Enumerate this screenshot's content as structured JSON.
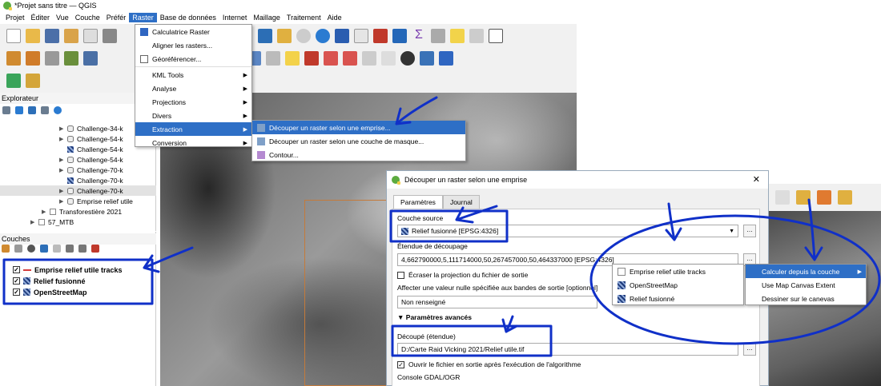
{
  "window": {
    "title": "*Projet sans titre — QGIS"
  },
  "menubar": {
    "items": [
      "Projet",
      "Éditer",
      "Vue",
      "Couche",
      "Préfér",
      "Raster",
      "Base de données",
      "Internet",
      "Maillage",
      "Traitement",
      "Aide"
    ],
    "active": "Raster"
  },
  "raster_menu": {
    "items": [
      {
        "label": "Calculatrice Raster",
        "icon": "calculator-icon"
      },
      {
        "label": "Aligner les rasters...",
        "icon": ""
      },
      {
        "label": "Géoréférencer...",
        "icon": "georeference-icon"
      },
      {
        "label": "KML Tools",
        "submenu": true
      },
      {
        "label": "Analyse",
        "submenu": true
      },
      {
        "label": "Projections",
        "submenu": true
      },
      {
        "label": "Divers",
        "submenu": true
      },
      {
        "label": "Extraction",
        "submenu": true,
        "highlighted": true
      },
      {
        "label": "Conversion",
        "submenu": true
      }
    ]
  },
  "extraction_menu": {
    "items": [
      {
        "label": "Découper un raster selon une emprise...",
        "highlighted": true
      },
      {
        "label": "Découper un raster selon une couche de masque..."
      },
      {
        "label": "Contour..."
      }
    ]
  },
  "explorer": {
    "title": "Explorateur",
    "tree": [
      {
        "label": "Challenge-34-k",
        "type": "db"
      },
      {
        "label": "Challenge-54-k",
        "type": "db"
      },
      {
        "label": "Challenge-54-k",
        "type": "raster"
      },
      {
        "label": "Challenge-54-k",
        "type": "db"
      },
      {
        "label": "Challenge-70-k",
        "type": "db"
      },
      {
        "label": "Challenge-70-k",
        "type": "raster"
      },
      {
        "label": "Challenge-70-k",
        "type": "db"
      },
      {
        "label": "Emprise relief utile",
        "type": "db"
      },
      {
        "label": "Transforestière 2021",
        "type": "folder"
      },
      {
        "label": "57_MTB",
        "type": "folder"
      }
    ]
  },
  "layers": {
    "title": "Couches",
    "items": [
      {
        "label": "Emprise relief utile tracks",
        "checked": true,
        "type": "line"
      },
      {
        "label": "Relief fusionné",
        "checked": true,
        "type": "raster"
      },
      {
        "label": "OpenStreetMap",
        "checked": true,
        "type": "raster"
      }
    ]
  },
  "dialog": {
    "title": "Découper un raster selon une emprise",
    "tabs": [
      "Paramètres",
      "Journal"
    ],
    "active_tab": "Paramètres",
    "source_label": "Couche source",
    "source_value": "Relief fusionné [EPSG:4326]",
    "extent_label": "Étendue de découpage",
    "extent_value": "4,662790000,5,111714000,50,267457000,50,464337000 [EPSG:4326]",
    "override_label": "Écraser la projection du fichier de sortie",
    "nodata_label": "Affecter une valeur nulle spécifiée aux bandes de sortie [optionnel]",
    "nodata_value": "Non renseigné",
    "advanced_label": "Paramètres avancés",
    "output_label": "Découpé (étendue)",
    "output_value": "D:/Carte Raid Vicking 2021/Relief utile.tif",
    "open_output_label": "Ouvrir le fichier en sortie après l'exécution de l'algorithme",
    "console_label": "Console GDAL/OGR"
  },
  "layer_menu": {
    "items": [
      "Emprise relief utile tracks",
      "OpenStreetMap",
      "Relief fusionné"
    ]
  },
  "calc_menu": {
    "items": [
      {
        "label": "Calculer depuis la couche",
        "highlighted": true,
        "submenu": true
      },
      {
        "label": "Use Map Canvas Extent"
      },
      {
        "label": "Dessiner sur le canevas"
      }
    ]
  },
  "colors": {
    "accent": "#2e6fc6",
    "annotation": "#1030c8"
  }
}
